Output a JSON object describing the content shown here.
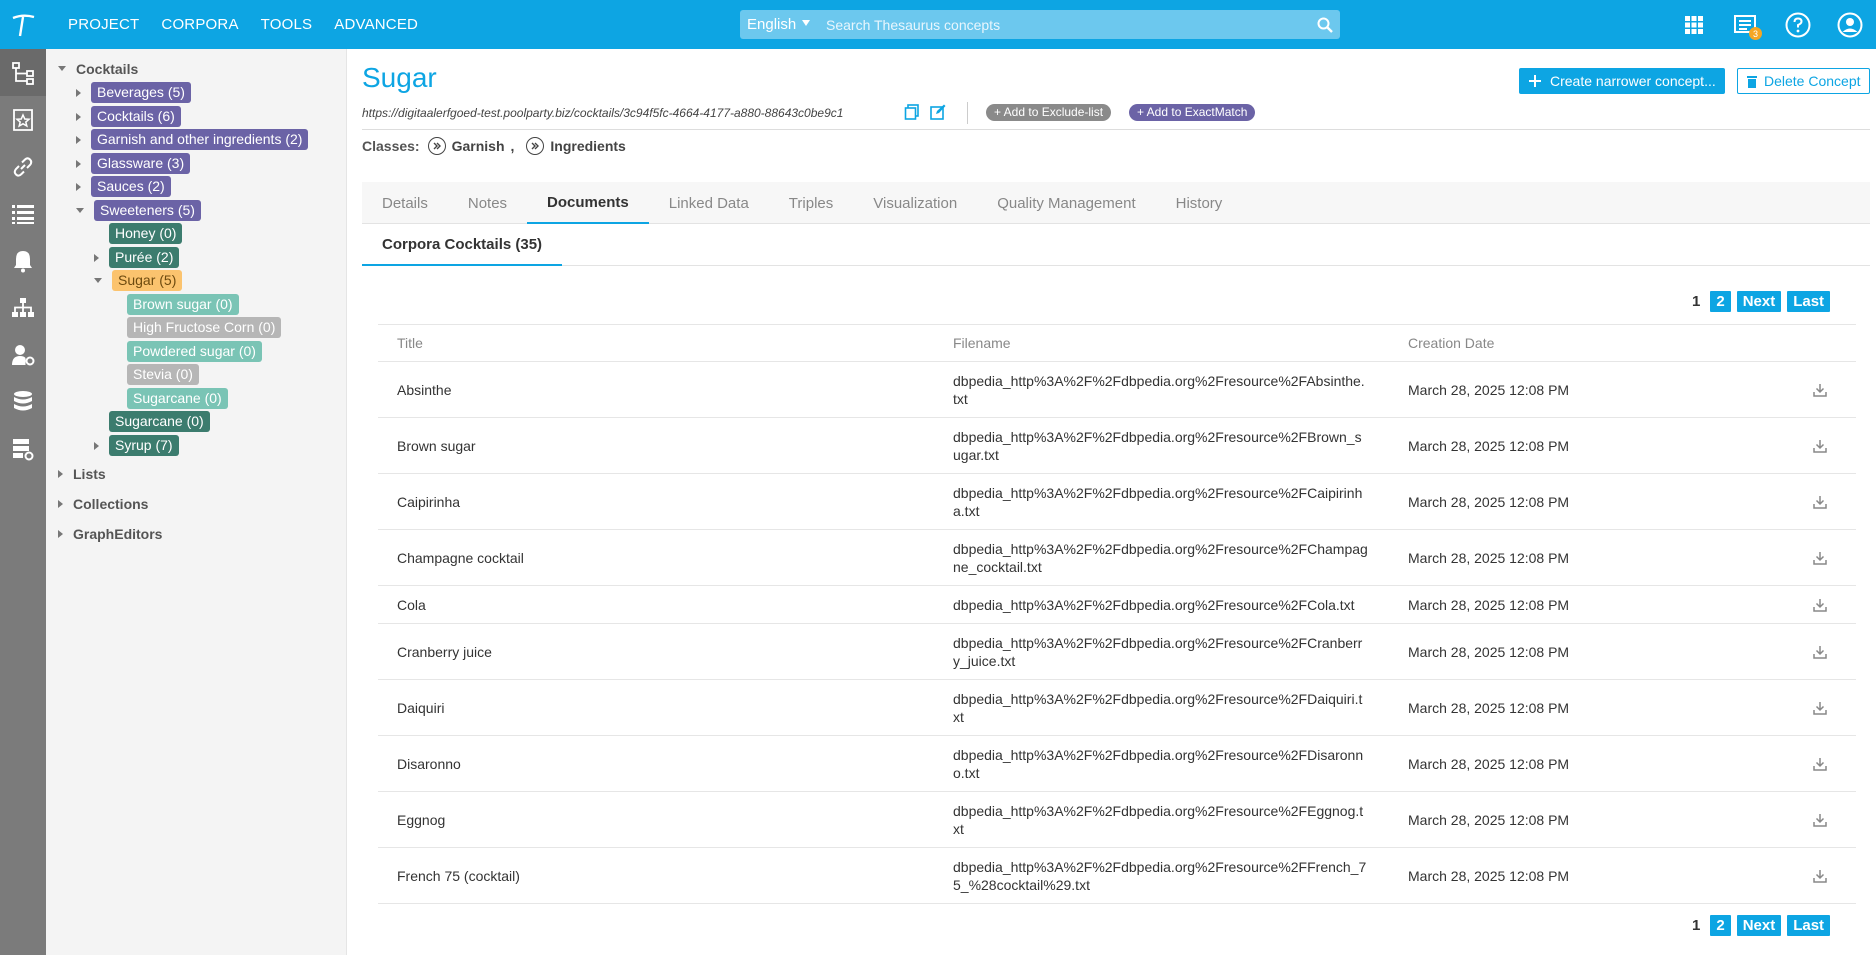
{
  "topbar": {
    "menu": [
      "PROJECT",
      "CORPORA",
      "TOOLS",
      "ADVANCED"
    ],
    "language": "English",
    "search_placeholder": "Search Thesaurus concepts",
    "notification_count": "3"
  },
  "tree": {
    "root": "Cocktails",
    "items": [
      {
        "label": "Beverages (5)",
        "color": "#6b63a6"
      },
      {
        "label": "Cocktails (6)",
        "color": "#6b63a6"
      },
      {
        "label": "Garnish and other ingredients (2)",
        "color": "#6b63a6"
      },
      {
        "label": "Glassware (3)",
        "color": "#6b63a6"
      },
      {
        "label": "Sauces (2)",
        "color": "#6b63a6"
      },
      {
        "label": "Sweeteners (5)",
        "color": "#6b63a6"
      },
      {
        "label": "Honey (0)",
        "color": "#3c7c6e"
      },
      {
        "label": "Purée (2)",
        "color": "#3c7c6e"
      },
      {
        "label": "Sugar (5)",
        "color": "#fbc36e"
      },
      {
        "label": "Brown sugar (0)",
        "color": "#7ac4b5"
      },
      {
        "label": "High Fructose Corn (0)",
        "color": "#b6b6b6"
      },
      {
        "label": "Powdered sugar (0)",
        "color": "#7ac4b5"
      },
      {
        "label": "Stevia (0)",
        "color": "#b6b6b6"
      },
      {
        "label": "Sugarcane (0)",
        "color": "#7ac4b5"
      },
      {
        "label": "Sugarcane (0)",
        "color": "#3c7c6e"
      },
      {
        "label": "Syrup (7)",
        "color": "#3c7c6e"
      }
    ],
    "sections": [
      "Lists",
      "Collections",
      "GraphEditors"
    ]
  },
  "concept": {
    "title": "Sugar",
    "uri": "https://digitaalerfgoed-test.poolparty.biz/cocktails/3c94f5fc-4664-4177-a880-88643c0be9c1",
    "add_exclude": "+ Add to Exclude-list",
    "add_exactmatch": "+ Add to ExactMatch",
    "create_narrower": "Create narrower concept...",
    "delete": "Delete Concept",
    "classes_label": "Classes:",
    "class_1": "Garnish",
    "class_sep": ",",
    "class_2": "Ingredients"
  },
  "tabs": [
    "Details",
    "Notes",
    "Documents",
    "Linked Data",
    "Triples",
    "Visualization",
    "Quality Management",
    "History"
  ],
  "active_tab": "Documents",
  "subtab": "Corpora Cocktails (35)",
  "pager": {
    "current": "1",
    "page2": "2",
    "next": "Next",
    "last": "Last"
  },
  "table": {
    "headers": [
      "Title",
      "Filename",
      "Creation Date"
    ],
    "rows": [
      {
        "title": "Absinthe",
        "file": "dbpedia_http%3A%2F%2Fdbpedia.org%2Fresource%2FAbsinthe.txt",
        "date": "March 28, 2025 12:08 PM"
      },
      {
        "title": "Brown sugar",
        "file": "dbpedia_http%3A%2F%2Fdbpedia.org%2Fresource%2FBrown_sugar.txt",
        "date": "March 28, 2025 12:08 PM"
      },
      {
        "title": "Caipirinha",
        "file": "dbpedia_http%3A%2F%2Fdbpedia.org%2Fresource%2FCaipirinha.txt",
        "date": "March 28, 2025 12:08 PM"
      },
      {
        "title": "Champagne cocktail",
        "file": "dbpedia_http%3A%2F%2Fdbpedia.org%2Fresource%2FChampagne_cocktail.txt",
        "date": "March 28, 2025 12:08 PM"
      },
      {
        "title": "Cola",
        "file": "dbpedia_http%3A%2F%2Fdbpedia.org%2Fresource%2FCola.txt",
        "date": "March 28, 2025 12:08 PM"
      },
      {
        "title": "Cranberry juice",
        "file": "dbpedia_http%3A%2F%2Fdbpedia.org%2Fresource%2FCranberry_juice.txt",
        "date": "March 28, 2025 12:08 PM"
      },
      {
        "title": "Daiquiri",
        "file": "dbpedia_http%3A%2F%2Fdbpedia.org%2Fresource%2FDaiquiri.txt",
        "date": "March 28, 2025 12:08 PM"
      },
      {
        "title": "Disaronno",
        "file": "dbpedia_http%3A%2F%2Fdbpedia.org%2Fresource%2FDisaronno.txt",
        "date": "March 28, 2025 12:08 PM"
      },
      {
        "title": "Eggnog",
        "file": "dbpedia_http%3A%2F%2Fdbpedia.org%2Fresource%2FEggnog.txt",
        "date": "March 28, 2025 12:08 PM"
      },
      {
        "title": "French 75 (cocktail)",
        "file": "dbpedia_http%3A%2F%2Fdbpedia.org%2Fresource%2FFrench_75_%28cocktail%29.txt",
        "date": "March 28, 2025 12:08 PM"
      }
    ]
  }
}
